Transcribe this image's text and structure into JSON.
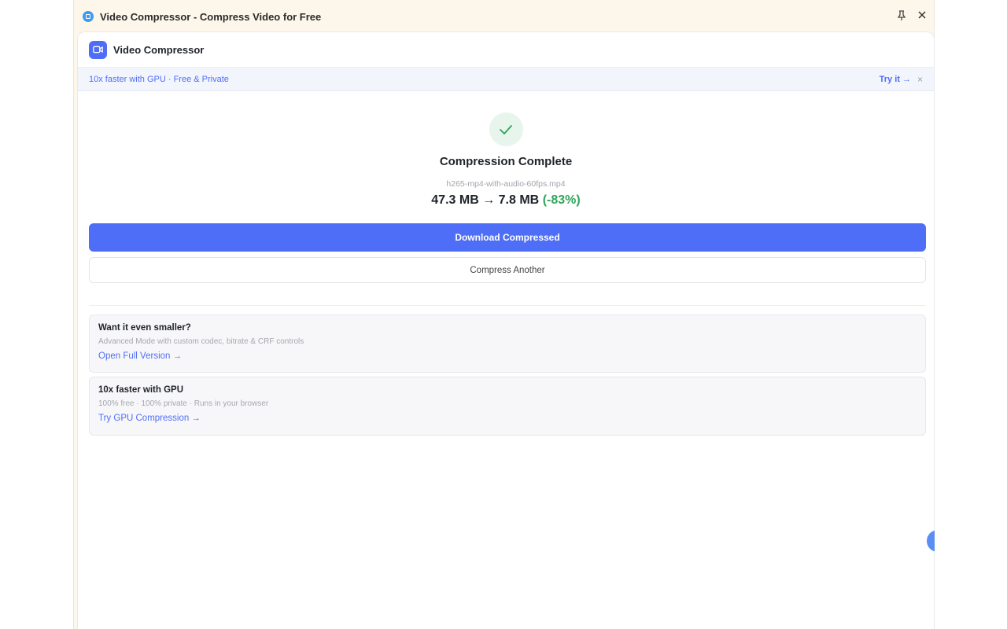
{
  "window": {
    "title": "Video Compressor - Compress Video for Free"
  },
  "header": {
    "app_name": "Video Compressor"
  },
  "banner": {
    "text": "10x faster with GPU · Free & Private",
    "link": "Try it →",
    "close": "×"
  },
  "result": {
    "title": "Compression Complete",
    "file_name": "h265-mp4-with-audio-60fps.mp4",
    "original_size": "47.3 MB",
    "arrow": "→",
    "compressed_size": "7.8 MB",
    "saving": "(-83%)"
  },
  "actions": {
    "download_label": "Download Compressed",
    "another_label": "Compress Another"
  },
  "cards": [
    {
      "title": "Want it even smaller?",
      "description": "Advanced Mode with custom codec, bitrate & CRF controls",
      "link": "Open Full Version →"
    },
    {
      "title": "10x faster with GPU",
      "description": "100% free · 100% private · Runs in your browser",
      "link": "Try GPU Compression →"
    }
  ],
  "icons": {
    "app": "app-icon",
    "pin": "pin-icon",
    "close": "close-icon",
    "logo": "video-camera-icon",
    "check": "check-icon"
  },
  "colors": {
    "accent": "#4f6ef7",
    "success": "#2fa55a",
    "titlebar_bg": "#fdf6ea"
  }
}
